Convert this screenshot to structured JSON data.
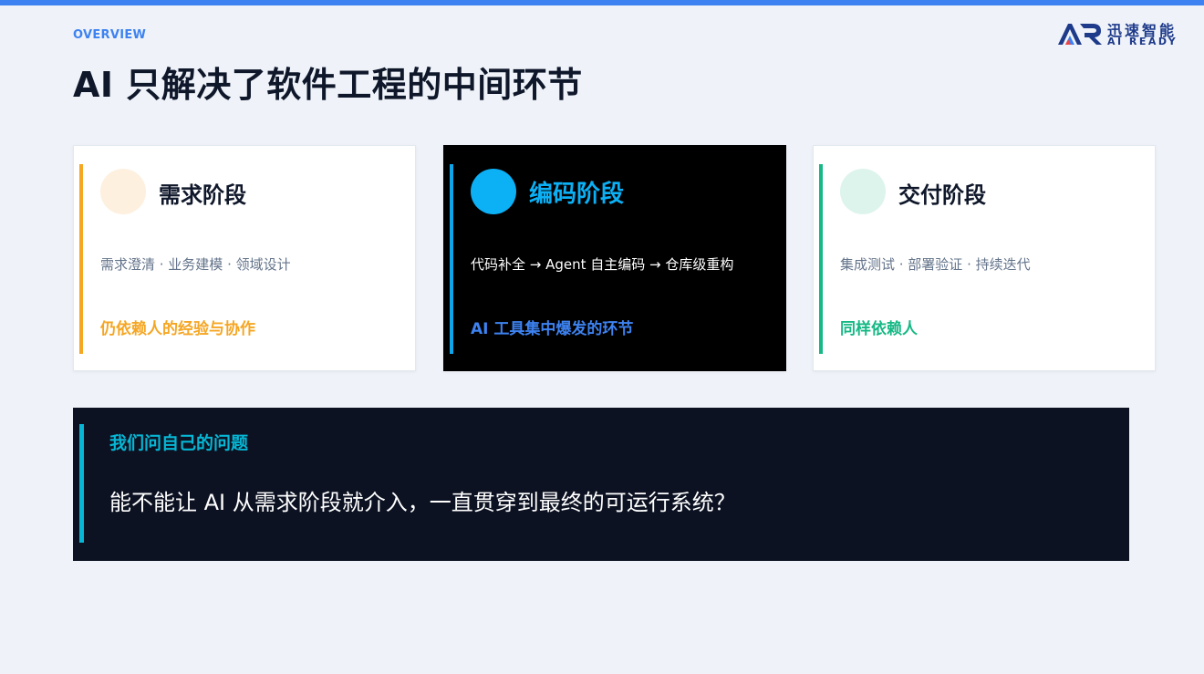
{
  "header": {
    "overline": "OVERVIEW",
    "title": "AI 只解决了软件工程的中间环节"
  },
  "logo": {
    "name_cn": "迅速智能",
    "name_en": "AI READY"
  },
  "stages": [
    {
      "name": "需求阶段",
      "description": "需求澄清 · 业务建模 · 领域设计",
      "note": "仍依赖人的经验与协作",
      "accent_color": "#f5a623",
      "circle_color": "#fdf0df",
      "note_color": "#f5a623",
      "theme": "light"
    },
    {
      "name": "编码阶段",
      "description": "代码补全 → Agent 自主编码 → 仓库级重构",
      "note": "AI 工具集中爆发的环节",
      "accent_color": "#0ea5e9",
      "circle_color": "#0bb0f5",
      "name_color": "#0bb0f5",
      "note_color": "#3d82f0",
      "theme": "dark"
    },
    {
      "name": "交付阶段",
      "description": "集成测试 · 部署验证 · 持续迭代",
      "note": "同样依赖人",
      "accent_color": "#16b885",
      "circle_color": "#ddf4ec",
      "note_color": "#16b885",
      "theme": "light"
    }
  ],
  "question": {
    "label": "我们问自己的问题",
    "text": "能不能让 AI 从需求阶段就介入，一直贯穿到最终的可运行系统？"
  }
}
